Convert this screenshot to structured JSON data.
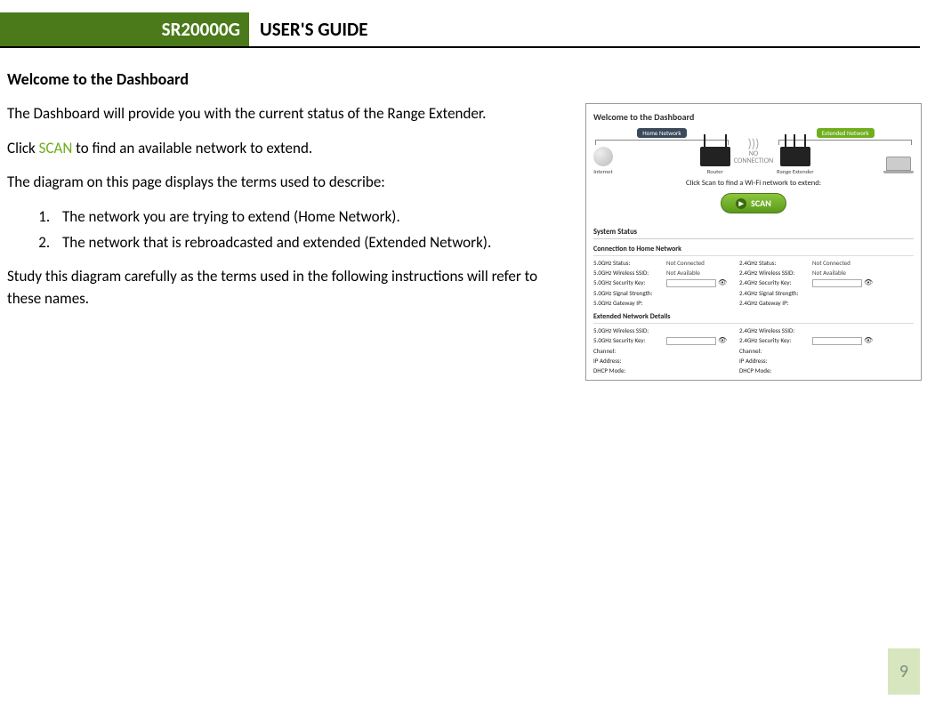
{
  "header": {
    "product": "SR20000G",
    "guide": "USER'S GUIDE"
  },
  "section_title": "Welcome to the Dashboard",
  "paragraphs": {
    "p1": "The Dashboard will provide you with the current status of the Range Extender.",
    "p2a": "Click ",
    "p2_scan": "SCAN",
    "p2b": " to find an available network to extend.",
    "p3": "The diagram on this page displays the terms used to describe:",
    "p4": "Study this diagram carefully as the terms used in the following instructions will refer to these names."
  },
  "list": {
    "item1": "The network you are trying to extend (Home Network).",
    "item2": "The network that is rebroadcasted and extended (Extended Network)."
  },
  "figure": {
    "title": "Welcome to the Dashboard",
    "home_net_label": "Home Network",
    "ext_net_label": "Extended Network",
    "internet": "Internet",
    "router": "Router",
    "extender": "Range Extender",
    "no_conn_top": "NO",
    "no_conn_bot": "CONNECTION",
    "scan_prompt": "Click Scan to find a Wi-Fi network to extend:",
    "scan_btn": "SCAN",
    "system_status": "System Status",
    "conn_home": "Connection to Home Network",
    "ext_details": "Extended Network Details",
    "labels": {
      "l5_status": "5.0GHz Status:",
      "l5_ssid": "5.0GHz Wireless SSID:",
      "l5_key": "5.0GHz Security Key:",
      "l5_sig": "5.0GHz Signal Strength:",
      "l5_gw": "5.0GHz Gateway IP:",
      "l24_status": "2.4GHz Status:",
      "l24_ssid": "2.4GHz Wireless SSID:",
      "l24_key": "2.4GHz Security Key:",
      "l24_sig": "2.4GHz Signal Strength:",
      "l24_gw": "2.4GHz Gateway IP:",
      "channel": "Channel:",
      "ip": "IP Address:",
      "dhcp": "DHCP Mode:"
    },
    "values": {
      "not_connected": "Not Connected",
      "not_available": "Not Available"
    }
  },
  "page_number": "9"
}
